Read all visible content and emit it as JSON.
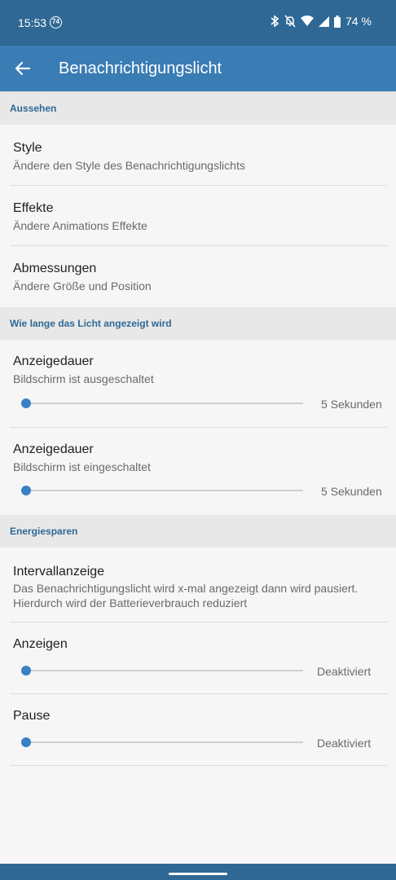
{
  "status_bar": {
    "time": "15:53",
    "badge": "74",
    "battery": "74 %",
    "icons": [
      "bluetooth-icon",
      "bell-off-icon",
      "wifi-icon",
      "cell-signal-icon",
      "battery-icon"
    ]
  },
  "app_bar": {
    "title": "Benachrichtigungslicht",
    "back_icon": "arrow-back-icon"
  },
  "sections": {
    "appearance": {
      "header": "Aussehen",
      "style": {
        "title": "Style",
        "subtitle": "Ändere den Style des Benachrichtigungslichts"
      },
      "effects": {
        "title": "Effekte",
        "subtitle": "Ändere Animations Effekte"
      },
      "dimensions": {
        "title": "Abmessungen",
        "subtitle": "Ändere Größe und Position"
      }
    },
    "duration": {
      "header": "Wie lange das Licht angezeigt wird",
      "screen_off": {
        "title": "Anzeigedauer",
        "subtitle": "Bildschirm ist ausgeschaltet",
        "value": "5 Sekunden",
        "slider_fraction": 0
      },
      "screen_on": {
        "title": "Anzeigedauer",
        "subtitle": "Bildschirm ist eingeschaltet",
        "value": "5 Sekunden",
        "slider_fraction": 0
      }
    },
    "energy": {
      "header": "Energiesparen",
      "interval": {
        "title": "Intervallanzeige",
        "subtitle_line1": "Das Benachrichtigungslicht wird x-mal angezeigt dann wird pausiert.",
        "subtitle_line2": "Hierdurch wird der Batterieverbrauch reduziert"
      },
      "show": {
        "title": "Anzeigen",
        "value": "Deaktiviert",
        "slider_fraction": 0
      },
      "pause": {
        "title": "Pause",
        "value": "Deaktiviert",
        "slider_fraction": 0
      }
    }
  },
  "colors": {
    "status_bar": "#2f6894",
    "app_bar": "#3a7cb4",
    "accent": "#3a80c4",
    "section_header_text": "#2f6894"
  }
}
